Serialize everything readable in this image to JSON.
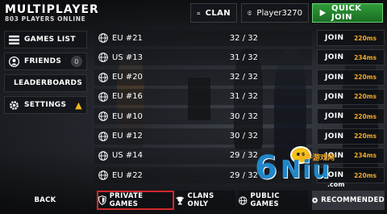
{
  "header": {
    "title": "Multiplayer",
    "subtitle": "803 players online"
  },
  "topbar": {
    "clan_label": "Clan",
    "player_name": "Player3270",
    "quick_join_label": "Quick Join"
  },
  "sidebar": {
    "items": [
      {
        "label": "Games List",
        "icon": "list-icon"
      },
      {
        "label": "Friends",
        "icon": "user-circle-icon",
        "count": "0"
      },
      {
        "label": "Leaderboards",
        "icon": "podium-icon"
      },
      {
        "label": "Settings",
        "icon": "gear-icon",
        "warning": "!"
      }
    ]
  },
  "servers": [
    {
      "name": "EU #21",
      "players": "32 / 32",
      "join": "Join",
      "ping": "220ms"
    },
    {
      "name": "US #13",
      "players": "31 / 32",
      "join": "Join",
      "ping": "234ms"
    },
    {
      "name": "EU #20",
      "players": "32 / 32",
      "join": "Join",
      "ping": "220ms"
    },
    {
      "name": "EU #16",
      "players": "31 / 32",
      "join": "Join",
      "ping": "220ms"
    },
    {
      "name": "EU #10",
      "players": "30 / 32",
      "join": "Join",
      "ping": "220ms"
    },
    {
      "name": "EU #12",
      "players": "30 / 32",
      "join": "Join",
      "ping": "220ms"
    },
    {
      "name": "US #14",
      "players": "29 / 32",
      "join": "Join",
      "ping": "234ms"
    },
    {
      "name": "EU #22",
      "players": "29 / 32",
      "join": "Join",
      "ping": "220ms"
    }
  ],
  "bottombar": {
    "back_label": "Back",
    "private_label": "Private Games",
    "clans_label": "Clans Only",
    "public_label": "Public Games",
    "recommended_label": "Recommended"
  },
  "watermark": {
    "brand": "6Niu",
    "cn_text": "乐牛游戏网",
    "url": ".com"
  },
  "colors": {
    "accent_green": "#2f9a3a",
    "ping_orange": "#f2a825",
    "highlight_red": "#d1282a",
    "warning_yellow": "#f3b51b"
  }
}
